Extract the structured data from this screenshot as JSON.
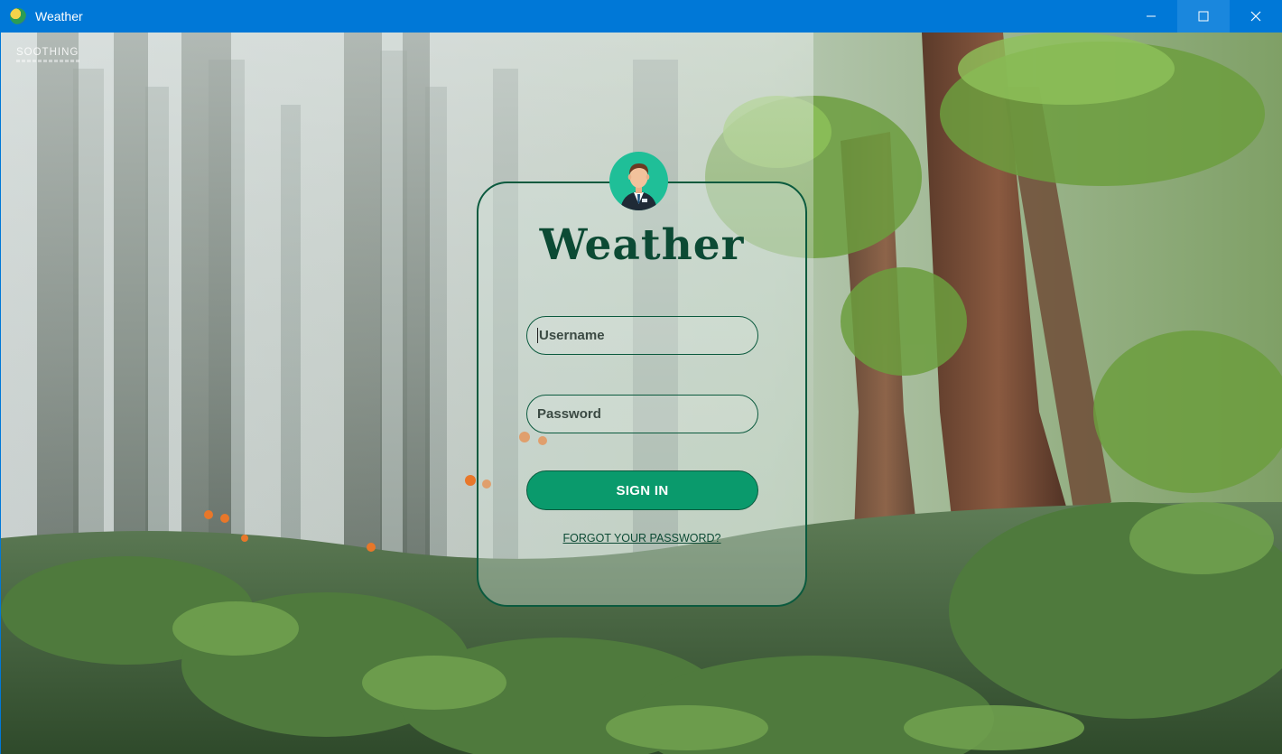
{
  "window": {
    "title": "Weather",
    "minimize_icon": "minimize-icon",
    "maximize_icon": "maximize-icon",
    "close_icon": "close-icon",
    "titlebar_color": "#0078d7"
  },
  "background": {
    "watermark": "SOOTHING"
  },
  "login": {
    "title": "Weather",
    "avatar_icon": "user-avatar-icon",
    "username_placeholder": "Username",
    "password_placeholder": "Password",
    "signin_label": "SIGN IN",
    "forgot_label": "FORGOT YOUR PASSWORD?",
    "accent_color": "#0a9a6c",
    "border_color": "#0b5a3e"
  }
}
